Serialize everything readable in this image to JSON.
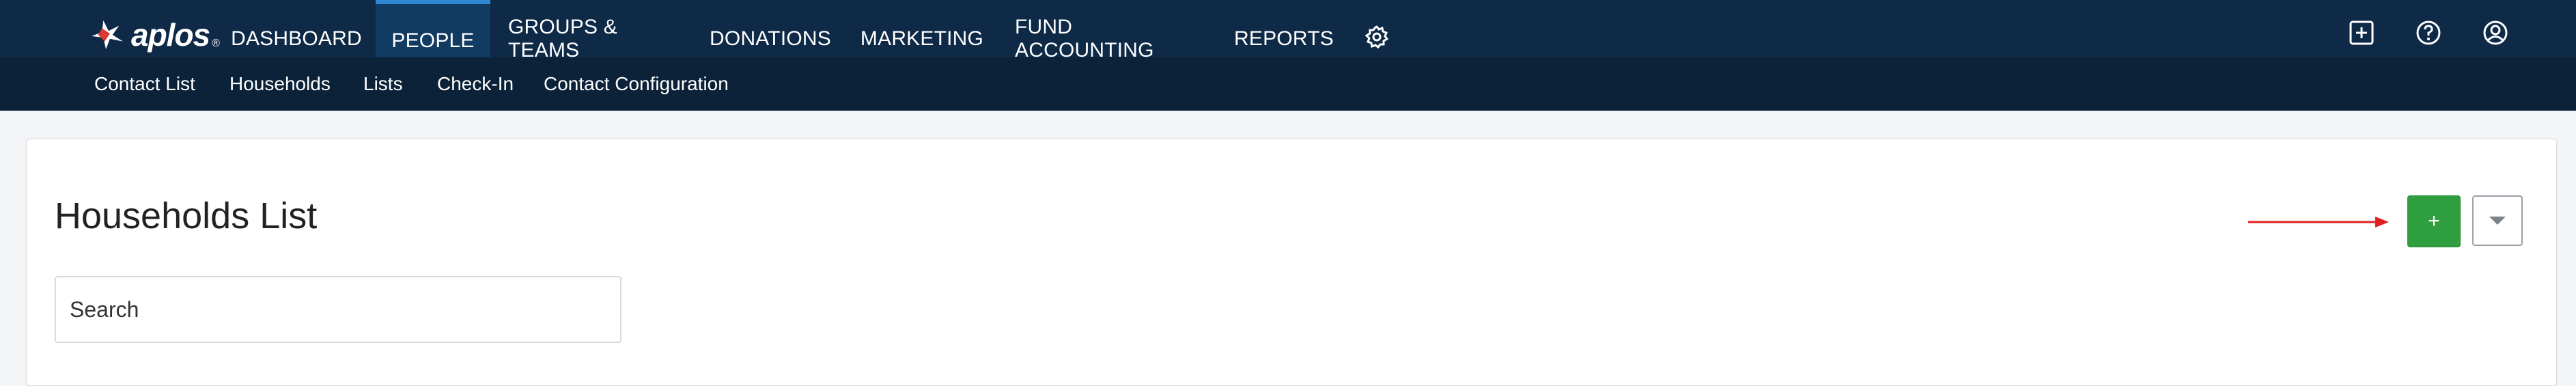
{
  "app": {
    "logo_text": "aplos",
    "logo_mark": "®"
  },
  "nav": {
    "items": [
      {
        "label": "DASHBOARD",
        "active": false
      },
      {
        "label": "PEOPLE",
        "active": true
      },
      {
        "label": "GROUPS & TEAMS",
        "active": false
      },
      {
        "label": "DONATIONS",
        "active": false
      },
      {
        "label": "MARKETING",
        "active": false
      },
      {
        "label": "FUND ACCOUNTING",
        "active": false
      },
      {
        "label": "REPORTS",
        "active": false
      }
    ],
    "settings_icon": "gear-icon",
    "right_icons": [
      "plus-square-icon",
      "help-icon",
      "user-profile-icon"
    ]
  },
  "subnav": {
    "items": [
      {
        "label": "Contact List"
      },
      {
        "label": "Households"
      },
      {
        "label": "Lists"
      },
      {
        "label": "Check-In"
      },
      {
        "label": "Contact Configuration"
      }
    ]
  },
  "page": {
    "title": "Households List",
    "search_placeholder": "Search",
    "add_label": "+",
    "dropdown_icon": "caret-down-icon"
  },
  "colors": {
    "nav_bg": "#0e2a47",
    "subnav_bg": "#0b2238",
    "active_tab_accent": "#2f86d3",
    "add_button": "#2f9e3f",
    "annotation_arrow": "#e02020"
  }
}
